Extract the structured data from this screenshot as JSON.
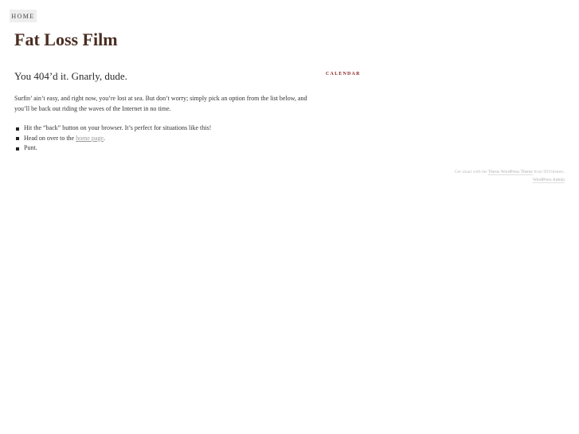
{
  "nav": {
    "home_label": "HOME"
  },
  "site": {
    "title": "Fat Loss Film"
  },
  "post": {
    "title": "You 404’d it. Gnarly, dude.",
    "intro": "Surfin’ ain’t easy, and right now, you’re lost at sea. But don’t worry; simply pick an option from the list below, and you’ll be back out riding the waves of the Internet in no time.",
    "options": [
      {
        "text": "Hit the “back” button on your browser. It’s perfect for situations like this!"
      },
      {
        "text_before": "Head on over to the ",
        "link": "home page",
        "text_after": "."
      },
      {
        "text": "Punt."
      }
    ]
  },
  "sidebar": {
    "calendar_heading": "CALENDAR"
  },
  "footer": {
    "prefix": "Get smart with the ",
    "theme_link": "Thesis WordPress Theme",
    "middle": " from DIYthemes.",
    "admin_link": "WordPress Admin"
  }
}
